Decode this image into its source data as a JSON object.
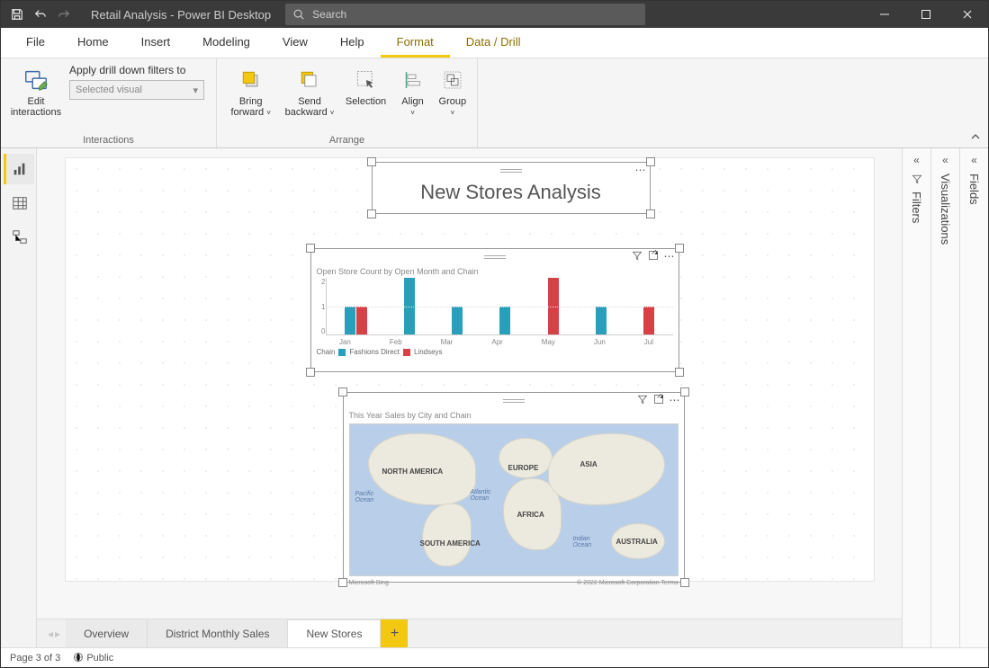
{
  "titlebar": {
    "title": "Retail Analysis - Power BI Desktop",
    "search_placeholder": "Search"
  },
  "menu": {
    "tabs": [
      "File",
      "Home",
      "Insert",
      "Modeling",
      "View",
      "Help",
      "Format",
      "Data / Drill"
    ],
    "active_index": 6
  },
  "ribbon": {
    "interactions": {
      "edit_label": "Edit\ninteractions",
      "drill_label": "Apply drill down filters to",
      "drill_select": "Selected visual",
      "group_label": "Interactions"
    },
    "arrange": {
      "bring_forward": "Bring\nforward",
      "send_backward": "Send\nbackward",
      "selection": "Selection",
      "align": "Align",
      "group": "Group",
      "group_label": "Arrange"
    }
  },
  "panes": {
    "filters": "Filters",
    "visualizations": "Visualizations",
    "fields": "Fields"
  },
  "canvas": {
    "title_visual": "New Stores Analysis",
    "bar_chart_title": "Open Store Count by Open Month and Chain",
    "legend_label": "Chain",
    "series_fd": "Fashions Direct",
    "series_ln": "Lindseys",
    "map_title": "This Year Sales by City and Chain",
    "map_attrib_left": "Microsoft Bing",
    "map_attrib_right": "© 2022 Microsoft Corporation  Terms"
  },
  "chart_data": {
    "type": "bar",
    "title": "Open Store Count by Open Month and Chain",
    "xlabel": "Open Month",
    "ylabel": "Open Store Count",
    "ylim": [
      0,
      2
    ],
    "categories": [
      "Jan",
      "Feb",
      "Mar",
      "Apr",
      "May",
      "Jun",
      "Jul"
    ],
    "series": [
      {
        "name": "Fashions Direct",
        "color": "#2a9fbb",
        "values": [
          1,
          2,
          1,
          1,
          0,
          1,
          0
        ]
      },
      {
        "name": "Lindseys",
        "color": "#d64145",
        "values": [
          1,
          0,
          0,
          0,
          2,
          0,
          1
        ]
      }
    ]
  },
  "map_labels": {
    "na": "NORTH AMERICA",
    "sa": "SOUTH AMERICA",
    "eu": "EUROPE",
    "af": "AFRICA",
    "as": "ASIA",
    "au": "AUSTRALIA",
    "pac": "Pacific\nOcean",
    "atl": "Atlantic\nOcean",
    "ind": "Indian\nOcean"
  },
  "page_tabs": {
    "tabs": [
      "Overview",
      "District Monthly Sales",
      "New Stores"
    ],
    "active_index": 2
  },
  "status": {
    "page": "Page 3 of 3",
    "publish": "Public"
  }
}
